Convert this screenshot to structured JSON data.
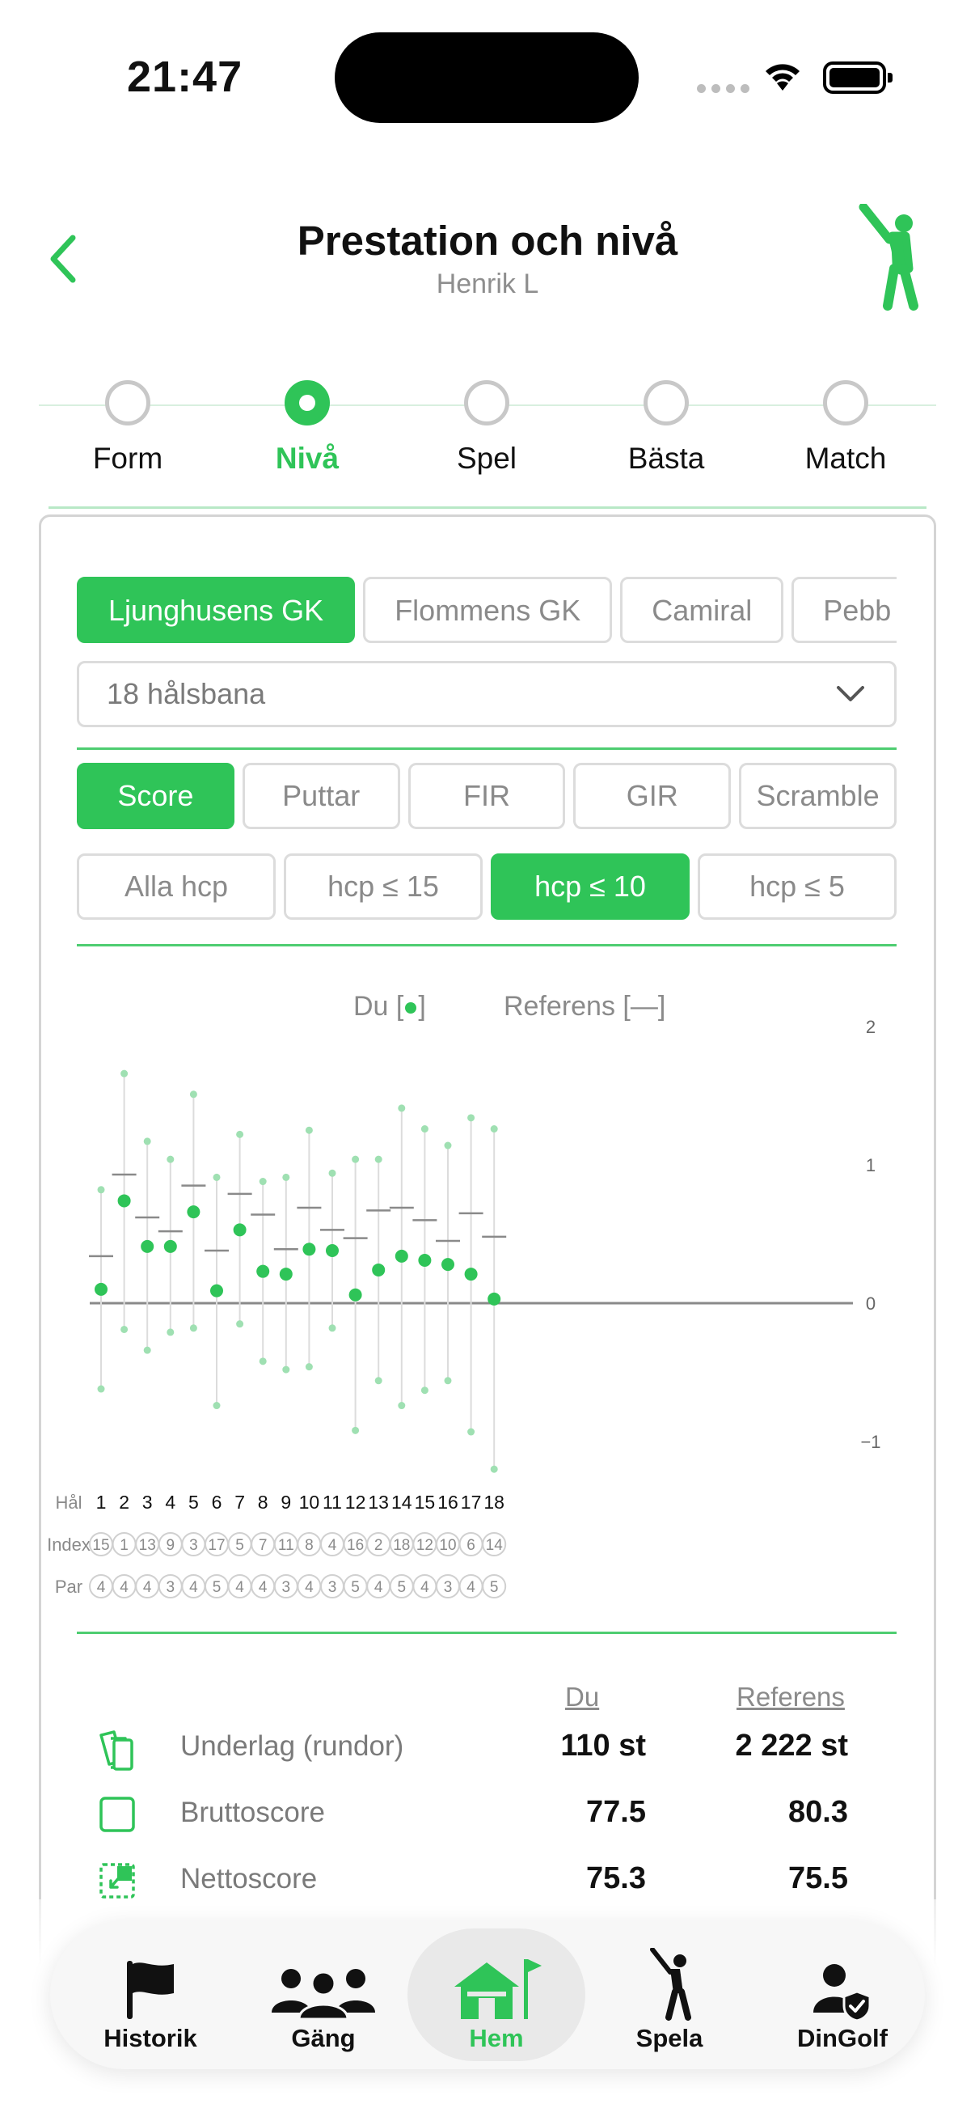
{
  "status": {
    "time": "21:47"
  },
  "header": {
    "title": "Prestation och nivå",
    "subtitle": "Henrik L"
  },
  "stepper": {
    "steps": [
      {
        "label": "Form",
        "active": false
      },
      {
        "label": "Nivå",
        "active": true
      },
      {
        "label": "Spel",
        "active": false
      },
      {
        "label": "Bästa",
        "active": false
      },
      {
        "label": "Match",
        "active": false
      }
    ]
  },
  "clubs": {
    "items": [
      "Ljunghusens GK",
      "Flommens GK",
      "Camiral",
      "Pebb"
    ],
    "selected": "Ljunghusens GK"
  },
  "course_select": {
    "value": "18 hålsbana"
  },
  "metrics": {
    "items": [
      "Score",
      "Puttar",
      "FIR",
      "GIR",
      "Scramble"
    ],
    "selected": "Score"
  },
  "hcp_filter": {
    "items": [
      "Alla hcp",
      "hcp ≤ 15",
      "hcp ≤ 10",
      "hcp ≤ 5"
    ],
    "selected": "hcp ≤ 10"
  },
  "legend": {
    "you": "Du [",
    "you_end": "]",
    "ref": "Referens [—]"
  },
  "row_labels": {
    "hole": "Hål",
    "index": "Index",
    "par": "Par"
  },
  "colors": {
    "accent": "#2fc458",
    "ref_mark": "#8a8a8a"
  },
  "chart_data": {
    "type": "scatter",
    "y_ticks": [
      "2",
      "1",
      "0",
      "−1"
    ],
    "ylim": [
      -1.2,
      2
    ],
    "x": [
      1,
      2,
      3,
      4,
      5,
      6,
      7,
      8,
      9,
      10,
      11,
      12,
      13,
      14,
      15,
      16,
      17,
      18
    ],
    "series": [
      {
        "name": "Du",
        "values": [
          0.1,
          0.74,
          0.41,
          0.41,
          0.66,
          0.09,
          0.53,
          0.23,
          0.21,
          0.39,
          0.38,
          0.06,
          0.24,
          0.34,
          0.31,
          0.28,
          0.21,
          0.03
        ],
        "upper": [
          0.82,
          1.66,
          1.17,
          1.04,
          1.51,
          0.91,
          1.22,
          0.88,
          0.91,
          1.25,
          0.94,
          1.04,
          1.04,
          1.41,
          1.26,
          1.14,
          1.34,
          1.26
        ],
        "lower": [
          -0.62,
          -0.19,
          -0.34,
          -0.21,
          -0.18,
          -0.74,
          -0.15,
          -0.42,
          -0.48,
          -0.46,
          -0.18,
          -0.92,
          -0.56,
          -0.74,
          -0.63,
          -0.56,
          -0.93,
          -1.2
        ]
      },
      {
        "name": "Referens",
        "values": [
          0.34,
          0.93,
          0.62,
          0.52,
          0.85,
          0.38,
          0.79,
          0.64,
          0.39,
          0.69,
          0.53,
          0.47,
          0.67,
          0.69,
          0.6,
          0.45,
          0.65,
          0.48
        ]
      }
    ]
  },
  "holes": [
    {
      "hole": "1",
      "index": "15",
      "par": "4"
    },
    {
      "hole": "2",
      "index": "1",
      "par": "4"
    },
    {
      "hole": "3",
      "index": "13",
      "par": "4"
    },
    {
      "hole": "4",
      "index": "9",
      "par": "3"
    },
    {
      "hole": "5",
      "index": "3",
      "par": "4"
    },
    {
      "hole": "6",
      "index": "17",
      "par": "5"
    },
    {
      "hole": "7",
      "index": "5",
      "par": "4"
    },
    {
      "hole": "8",
      "index": "7",
      "par": "4"
    },
    {
      "hole": "9",
      "index": "11",
      "par": "3"
    },
    {
      "hole": "10",
      "index": "8",
      "par": "4"
    },
    {
      "hole": "11",
      "index": "4",
      "par": "3"
    },
    {
      "hole": "12",
      "index": "16",
      "par": "5"
    },
    {
      "hole": "13",
      "index": "2",
      "par": "4"
    },
    {
      "hole": "14",
      "index": "18",
      "par": "5"
    },
    {
      "hole": "15",
      "index": "12",
      "par": "4"
    },
    {
      "hole": "16",
      "index": "10",
      "par": "3"
    },
    {
      "hole": "17",
      "index": "6",
      "par": "4"
    },
    {
      "hole": "18",
      "index": "14",
      "par": "5"
    }
  ],
  "stats": {
    "col_you": "Du",
    "col_ref": "Referens",
    "rows": [
      {
        "name": "Underlag (rundor)",
        "you": "110 st",
        "ref": "2 222 st",
        "icon": "cards-icon"
      },
      {
        "name": "Bruttoscore",
        "you": "77.5",
        "ref": "80.3",
        "icon": "square-icon"
      },
      {
        "name": "Nettoscore",
        "you": "75.3",
        "ref": "75.5",
        "icon": "net-square-icon"
      }
    ]
  },
  "tabbar": {
    "items": [
      {
        "label": "Historik",
        "icon": "flag-icon"
      },
      {
        "label": "Gäng",
        "icon": "group-icon"
      },
      {
        "label": "Hem",
        "icon": "home-icon",
        "active": true
      },
      {
        "label": "Spela",
        "icon": "golfer-icon"
      },
      {
        "label": "DinGolf",
        "icon": "user-shield-icon"
      }
    ]
  }
}
